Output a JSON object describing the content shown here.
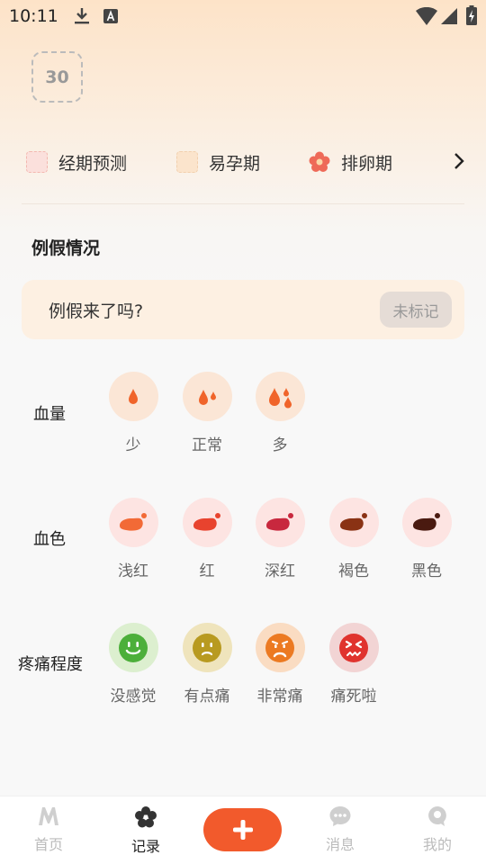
{
  "status_bar": {
    "time": "10:11"
  },
  "calendar": {
    "day": "30"
  },
  "legend": [
    {
      "label": "经期预测",
      "color": "#fbe0dc",
      "border": "#f3b8b0"
    },
    {
      "label": "易孕期",
      "color": "#fbe4cc",
      "border": "#f2d0ae"
    },
    {
      "label": "排卵期",
      "color": "#ee6a58",
      "icon": "flower-icon"
    }
  ],
  "period": {
    "title": "例假情况",
    "question": "例假来了吗?",
    "mark_button": "未标记"
  },
  "flow": {
    "label": "血量",
    "options": [
      "少",
      "正常",
      "多"
    ]
  },
  "color": {
    "label": "血色",
    "options": [
      {
        "label": "浅红",
        "color": "#f26a36",
        "bg": "#fde4e2"
      },
      {
        "label": "红",
        "color": "#e8432e",
        "bg": "#fde4e2"
      },
      {
        "label": "深红",
        "color": "#c8283e",
        "bg": "#fde4e2"
      },
      {
        "label": "褐色",
        "color": "#8a3214",
        "bg": "#fde4e2"
      },
      {
        "label": "黑色",
        "color": "#4a1a10",
        "bg": "#fde4e2"
      }
    ]
  },
  "pain": {
    "label": "疼痛程度",
    "options": [
      {
        "label": "没感觉",
        "color": "#4caf3a",
        "bg": "#dcefcf",
        "icon": "smile-face-icon"
      },
      {
        "label": "有点痛",
        "color": "#b89a20",
        "bg": "#efe4bc",
        "icon": "slight-frown-face-icon"
      },
      {
        "label": "非常痛",
        "color": "#ec7a22",
        "bg": "#fadcc2",
        "icon": "frown-face-icon"
      },
      {
        "label": "痛死啦",
        "color": "#e0332e",
        "bg": "#f2d4d4",
        "icon": "crying-face-icon"
      }
    ]
  },
  "nav": {
    "items": [
      {
        "label": "首页",
        "icon": "m-logo-icon",
        "active": false
      },
      {
        "label": "记录",
        "icon": "flower-icon",
        "active": true
      },
      {
        "label": "消息",
        "icon": "chat-bubble-icon",
        "active": false
      },
      {
        "label": "我的",
        "icon": "profile-icon",
        "active": false
      }
    ],
    "add_icon": "plus-icon"
  },
  "colors": {
    "accent": "#f25a2c",
    "text_muted": "#999999"
  }
}
